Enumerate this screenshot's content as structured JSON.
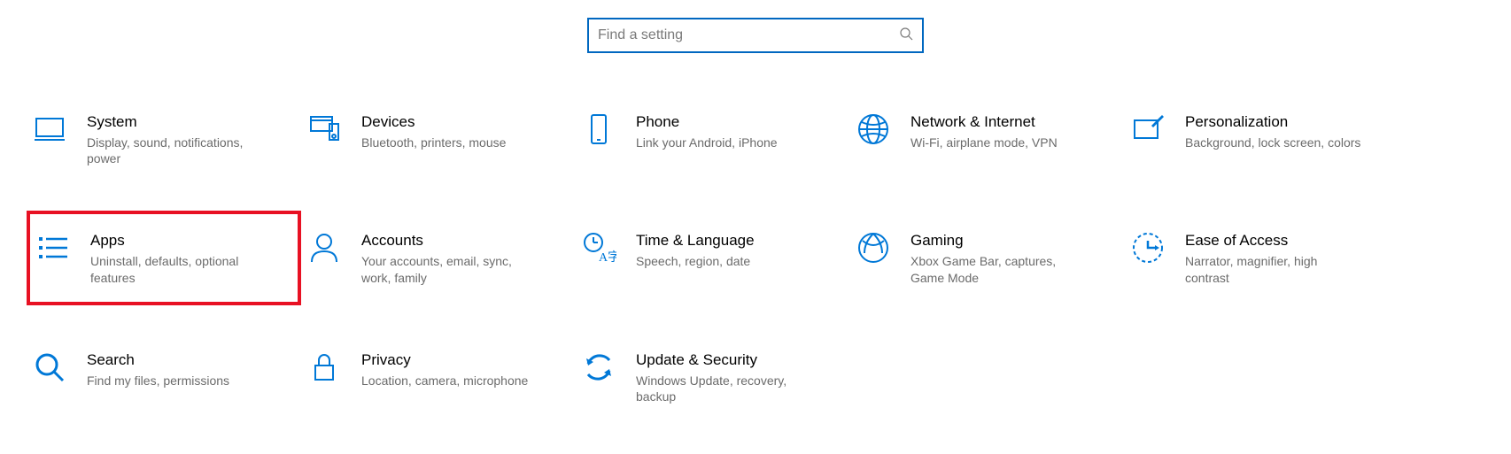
{
  "search": {
    "placeholder": "Find a setting"
  },
  "tiles": {
    "system": {
      "title": "System",
      "desc": "Display, sound, notifications, power"
    },
    "devices": {
      "title": "Devices",
      "desc": "Bluetooth, printers, mouse"
    },
    "phone": {
      "title": "Phone",
      "desc": "Link your Android, iPhone"
    },
    "network": {
      "title": "Network & Internet",
      "desc": "Wi-Fi, airplane mode, VPN"
    },
    "personalization": {
      "title": "Personalization",
      "desc": "Background, lock screen, colors"
    },
    "apps": {
      "title": "Apps",
      "desc": "Uninstall, defaults, optional features"
    },
    "accounts": {
      "title": "Accounts",
      "desc": "Your accounts, email, sync, work, family"
    },
    "time": {
      "title": "Time & Language",
      "desc": "Speech, region, date"
    },
    "gaming": {
      "title": "Gaming",
      "desc": "Xbox Game Bar, captures, Game Mode"
    },
    "ease": {
      "title": "Ease of Access",
      "desc": "Narrator, magnifier, high contrast"
    },
    "search": {
      "title": "Search",
      "desc": "Find my files, permissions"
    },
    "privacy": {
      "title": "Privacy",
      "desc": "Location, camera, microphone"
    },
    "update": {
      "title": "Update & Security",
      "desc": "Windows Update, recovery, backup"
    }
  },
  "colors": {
    "accent": "#0078d7",
    "highlight": "#e81123",
    "searchBorder": "#0067c0"
  }
}
